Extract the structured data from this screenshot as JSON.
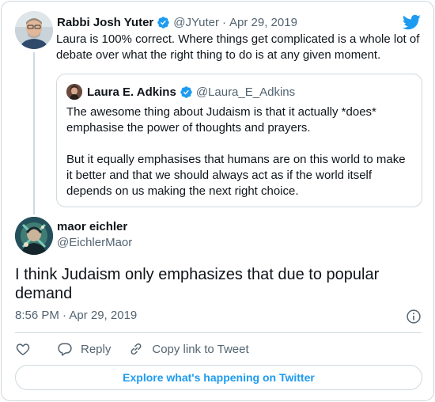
{
  "parent_tweet": {
    "author_name": "Rabbi Josh Yuter",
    "author_handle": "@JYuter",
    "separator": "·",
    "date": "Apr 29, 2019",
    "text": "Laura is 100% correct. Where things get complicated is a whole lot of debate over what the right thing to do is at any given moment."
  },
  "quoted_tweet": {
    "author_name": "Laura E. Adkins",
    "author_handle": "@Laura_E_Adkins",
    "paragraphs": [
      "The awesome thing about Judaism is that it actually *does* emphasise the power of thoughts and prayers.",
      "But it equally emphasises that humans are on this world to make it better and that we should always act as if the world itself depends on us making the next right choice."
    ]
  },
  "main_tweet": {
    "author_name": "maor eichler",
    "author_handle": "@EichlerMaor",
    "text": "I think Judaism only emphasizes that due to popular demand",
    "timestamp": "8:56 PM · Apr 29, 2019"
  },
  "actions": {
    "reply_label": "Reply",
    "copy_link_label": "Copy link to Tweet"
  },
  "explore_label": "Explore what's happening on Twitter",
  "icons": {
    "verified": "verified-badge-icon",
    "twitter": "twitter-bird-icon",
    "like": "heart-icon",
    "reply": "reply-bubble-icon",
    "copy_link": "link-icon",
    "info": "info-icon"
  },
  "colors": {
    "twitter_blue": "#1d9bf0",
    "text_primary": "#0f1419",
    "text_secondary": "#536471",
    "border": "#cfd9de"
  }
}
